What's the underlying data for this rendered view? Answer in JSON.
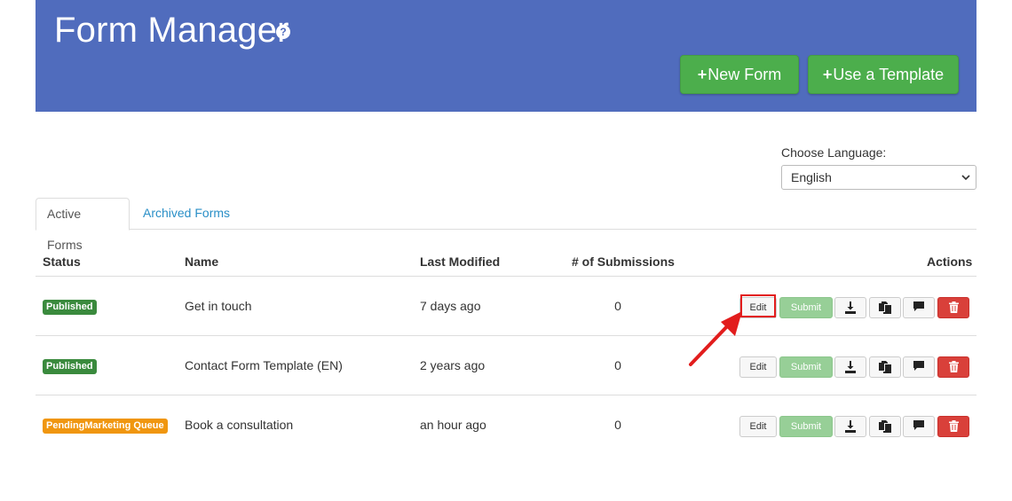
{
  "header": {
    "title": "Form Manager",
    "help_glyph": "?",
    "new_form_label": "New Form",
    "use_template_label": "Use a Template",
    "plus_glyph": "+"
  },
  "language": {
    "label": "Choose Language:",
    "selected": "English"
  },
  "tabs": [
    {
      "label": "Active Forms",
      "active": true
    },
    {
      "label": "Archived Forms",
      "active": false
    }
  ],
  "table": {
    "columns": [
      "Status",
      "Name",
      "Last Modified",
      "# of Submissions",
      "Actions"
    ],
    "rows": [
      {
        "status": "Published",
        "status_color": "#3a8a3d",
        "name": "Get in touch",
        "last_modified": "7 days ago",
        "submissions": "0"
      },
      {
        "status": "Published",
        "status_color": "#3a8a3d",
        "name": "Contact Form Template (EN)",
        "last_modified": "2 years ago",
        "submissions": "0"
      },
      {
        "status": "PendingMarketing Queue",
        "status_color": "#f0960f",
        "name": "Book a consultation",
        "last_modified": "an hour ago",
        "submissions": "0"
      }
    ],
    "actions": {
      "edit_label": "Edit",
      "submit_label": "Submit",
      "icons": [
        "download-icon",
        "copy-icon",
        "comment-icon",
        "trash-icon"
      ]
    }
  },
  "colors": {
    "header_bg": "#506cbd",
    "primary_green": "#4cae4c",
    "danger_red": "#d9403a",
    "annotation_red": "#e21d1d"
  }
}
